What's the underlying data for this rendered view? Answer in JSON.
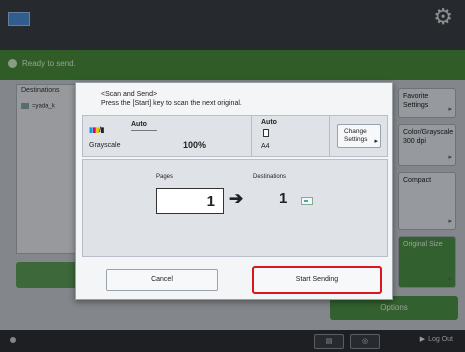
{
  "colors": {
    "accent_green": "#4a8f3c",
    "highlight_red": "#d9151e",
    "topbar": "#3b4048"
  },
  "header": {
    "status": "Ready to send."
  },
  "destinations": {
    "heading": "Destinations",
    "item": "=yada_k"
  },
  "sidebar_buttons": [
    {
      "label": "Favorite Settings"
    },
    {
      "label": "Color/Grayscale 300 dpi"
    },
    {
      "label": "Compact"
    },
    {
      "label": "Original Size"
    }
  ],
  "options_label": "Options",
  "bottom": {
    "logout_label": "Log Out"
  },
  "dialog": {
    "title_line1": "<Scan and Send>",
    "title_line2": "Press the [Start] key to scan the next original.",
    "color_mode_short": "▮▮/▮",
    "auto_a": "Auto",
    "color_mode": "Grayscale",
    "zoom": "100%",
    "auto_b": "Auto",
    "paper_size": "A4",
    "change_settings_line1": "Change",
    "change_settings_line2": "Settings",
    "pages_label": "Pages",
    "pages_value": "1",
    "destinations_label": "Destinations",
    "destinations_value": "1",
    "cancel_label": "Cancel",
    "start_sending_label": "Start Sending"
  }
}
